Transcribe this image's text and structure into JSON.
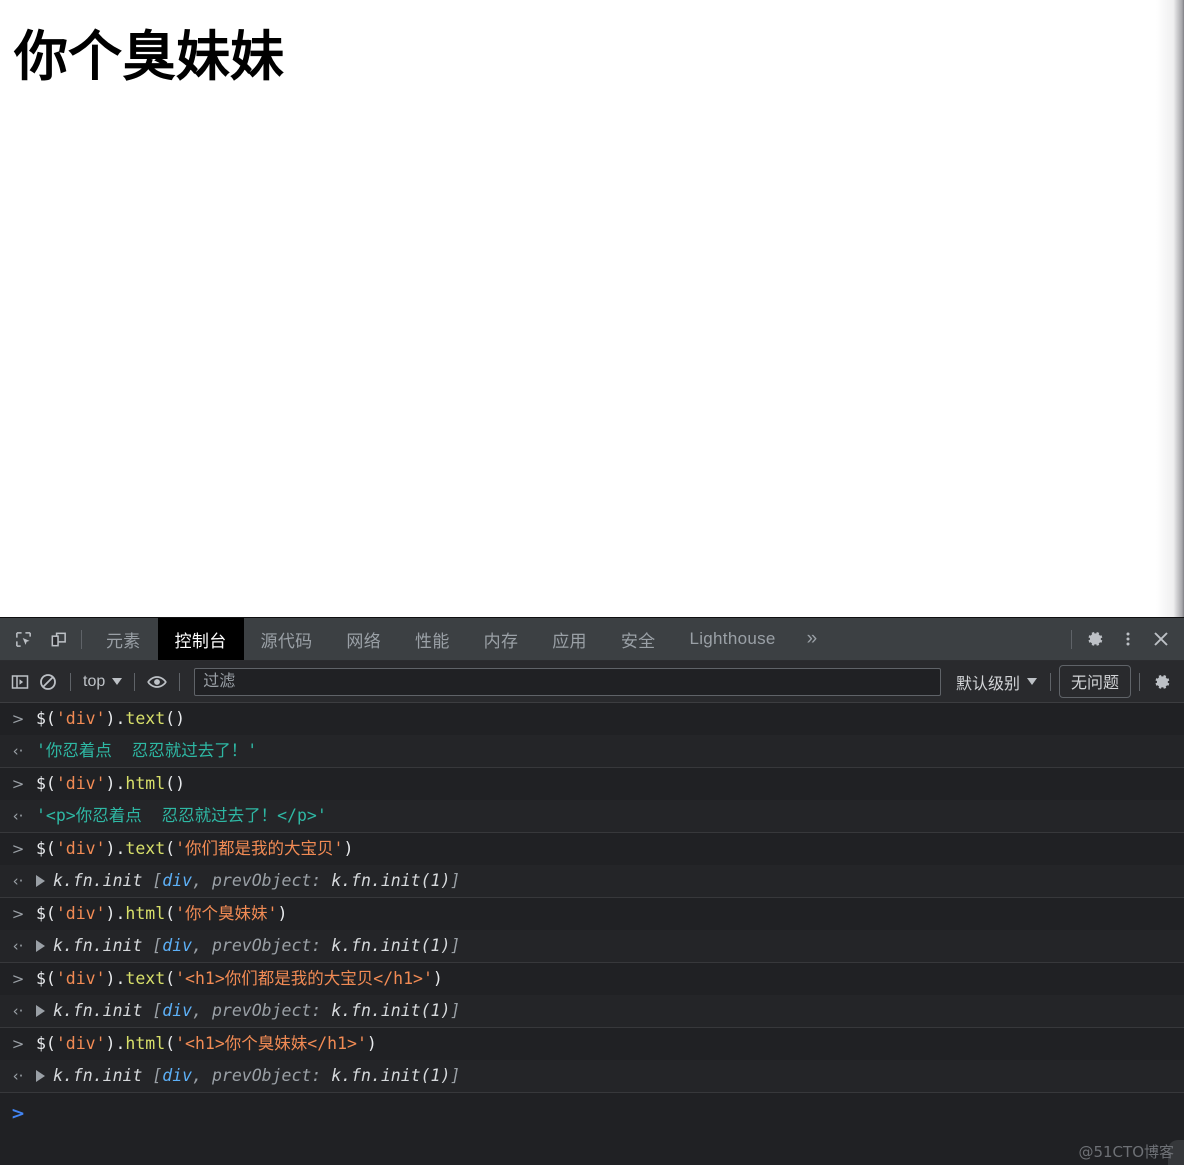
{
  "page": {
    "heading": "你个臭妹妹"
  },
  "devtools": {
    "toolbar_icons": {
      "inspect": "inspect-element-icon",
      "device": "device-toolbar-icon",
      "settings": "gear-icon",
      "more": "more-vertical-icon",
      "close": "close-icon"
    },
    "tabs": [
      {
        "label": "元素",
        "active": false
      },
      {
        "label": "控制台",
        "active": true
      },
      {
        "label": "源代码",
        "active": false
      },
      {
        "label": "网络",
        "active": false
      },
      {
        "label": "性能",
        "active": false
      },
      {
        "label": "内存",
        "active": false
      },
      {
        "label": "应用",
        "active": false
      },
      {
        "label": "安全",
        "active": false
      },
      {
        "label": "Lighthouse",
        "active": false
      }
    ],
    "more_tabs_label": "»"
  },
  "console_toolbar": {
    "sidebar_toggle": "console-sidebar-icon",
    "clear_console": "clear-console-icon",
    "context_value": "top",
    "eye_icon": "live-expression-icon",
    "filter_placeholder": "过滤",
    "filter_value": "",
    "level_label": "默认级别",
    "issues_label": "无问题",
    "settings_icon": "gear-icon"
  },
  "console_log": {
    "input_marker": ">",
    "output_marker": "‹·",
    "groups": [
      {
        "input": [
          {
            "t": "$(",
            "c": "t-plain"
          },
          {
            "t": "'div'",
            "c": "t-str"
          },
          {
            "t": ").",
            "c": "t-plain"
          },
          {
            "t": "text",
            "c": "t-method"
          },
          {
            "t": "()",
            "c": "t-plain"
          }
        ],
        "output_kind": "string",
        "output": [
          {
            "t": "'你忍着点  忍忍就过去了！'",
            "c": "t-strout"
          }
        ]
      },
      {
        "input": [
          {
            "t": "$(",
            "c": "t-plain"
          },
          {
            "t": "'div'",
            "c": "t-str"
          },
          {
            "t": ").",
            "c": "t-plain"
          },
          {
            "t": "html",
            "c": "t-method"
          },
          {
            "t": "()",
            "c": "t-plain"
          }
        ],
        "output_kind": "string",
        "output": [
          {
            "t": "'<p>你忍着点  忍忍就过去了！</p>'",
            "c": "t-strout"
          }
        ]
      },
      {
        "input": [
          {
            "t": "$(",
            "c": "t-plain"
          },
          {
            "t": "'div'",
            "c": "t-str"
          },
          {
            "t": ").",
            "c": "t-plain"
          },
          {
            "t": "text",
            "c": "t-method"
          },
          {
            "t": "(",
            "c": "t-plain"
          },
          {
            "t": "'你们都是我的大宝贝'",
            "c": "t-str"
          },
          {
            "t": ")",
            "c": "t-plain"
          }
        ],
        "output_kind": "object",
        "output": [
          {
            "t": "k.fn.init ",
            "c": "t-obj"
          },
          {
            "t": "[",
            "c": "t-gray"
          },
          {
            "t": "div",
            "c": "t-blue"
          },
          {
            "t": ", ",
            "c": "t-gray"
          },
          {
            "t": "prevObject: ",
            "c": "t-gray"
          },
          {
            "t": "k.fn.init(1)",
            "c": "t-obj"
          },
          {
            "t": "]",
            "c": "t-gray"
          }
        ]
      },
      {
        "input": [
          {
            "t": "$(",
            "c": "t-plain"
          },
          {
            "t": "'div'",
            "c": "t-str"
          },
          {
            "t": ").",
            "c": "t-plain"
          },
          {
            "t": "html",
            "c": "t-method"
          },
          {
            "t": "(",
            "c": "t-plain"
          },
          {
            "t": "'你个臭妹妹'",
            "c": "t-str"
          },
          {
            "t": ")",
            "c": "t-plain"
          }
        ],
        "output_kind": "object",
        "output": [
          {
            "t": "k.fn.init ",
            "c": "t-obj"
          },
          {
            "t": "[",
            "c": "t-gray"
          },
          {
            "t": "div",
            "c": "t-blue"
          },
          {
            "t": ", ",
            "c": "t-gray"
          },
          {
            "t": "prevObject: ",
            "c": "t-gray"
          },
          {
            "t": "k.fn.init(1)",
            "c": "t-obj"
          },
          {
            "t": "]",
            "c": "t-gray"
          }
        ]
      },
      {
        "input": [
          {
            "t": "$(",
            "c": "t-plain"
          },
          {
            "t": "'div'",
            "c": "t-str"
          },
          {
            "t": ").",
            "c": "t-plain"
          },
          {
            "t": "text",
            "c": "t-method"
          },
          {
            "t": "(",
            "c": "t-plain"
          },
          {
            "t": "'<h1>你们都是我的大宝贝</h1>'",
            "c": "t-str"
          },
          {
            "t": ")",
            "c": "t-plain"
          }
        ],
        "output_kind": "object",
        "output": [
          {
            "t": "k.fn.init ",
            "c": "t-obj"
          },
          {
            "t": "[",
            "c": "t-gray"
          },
          {
            "t": "div",
            "c": "t-blue"
          },
          {
            "t": ", ",
            "c": "t-gray"
          },
          {
            "t": "prevObject: ",
            "c": "t-gray"
          },
          {
            "t": "k.fn.init(1)",
            "c": "t-obj"
          },
          {
            "t": "]",
            "c": "t-gray"
          }
        ]
      },
      {
        "input": [
          {
            "t": "$(",
            "c": "t-plain"
          },
          {
            "t": "'div'",
            "c": "t-str"
          },
          {
            "t": ").",
            "c": "t-plain"
          },
          {
            "t": "html",
            "c": "t-method"
          },
          {
            "t": "(",
            "c": "t-plain"
          },
          {
            "t": "'<h1>你个臭妹妹</h1>'",
            "c": "t-str"
          },
          {
            "t": ")",
            "c": "t-plain"
          }
        ],
        "output_kind": "object",
        "output": [
          {
            "t": "k.fn.init ",
            "c": "t-obj"
          },
          {
            "t": "[",
            "c": "t-gray"
          },
          {
            "t": "div",
            "c": "t-blue"
          },
          {
            "t": ", ",
            "c": "t-gray"
          },
          {
            "t": "prevObject: ",
            "c": "t-gray"
          },
          {
            "t": "k.fn.init(1)",
            "c": "t-obj"
          },
          {
            "t": "]",
            "c": "t-gray"
          }
        ]
      }
    ],
    "prompt_marker": ">",
    "prompt_value": ""
  },
  "watermark": {
    "text": "@51CTO博客"
  },
  "colors": {
    "devtools_bg": "#202124",
    "tabstrip_bg": "#3c4043",
    "toolbar_bg": "#292a2d",
    "active_tab_bg": "#000000",
    "string_token": "#f28b54",
    "method_token": "#d8e06a",
    "string_result": "#2eb8a4",
    "object_blue": "#5db0f7",
    "prompt_blue": "#4285f4",
    "muted_text": "#9aa0a6"
  }
}
